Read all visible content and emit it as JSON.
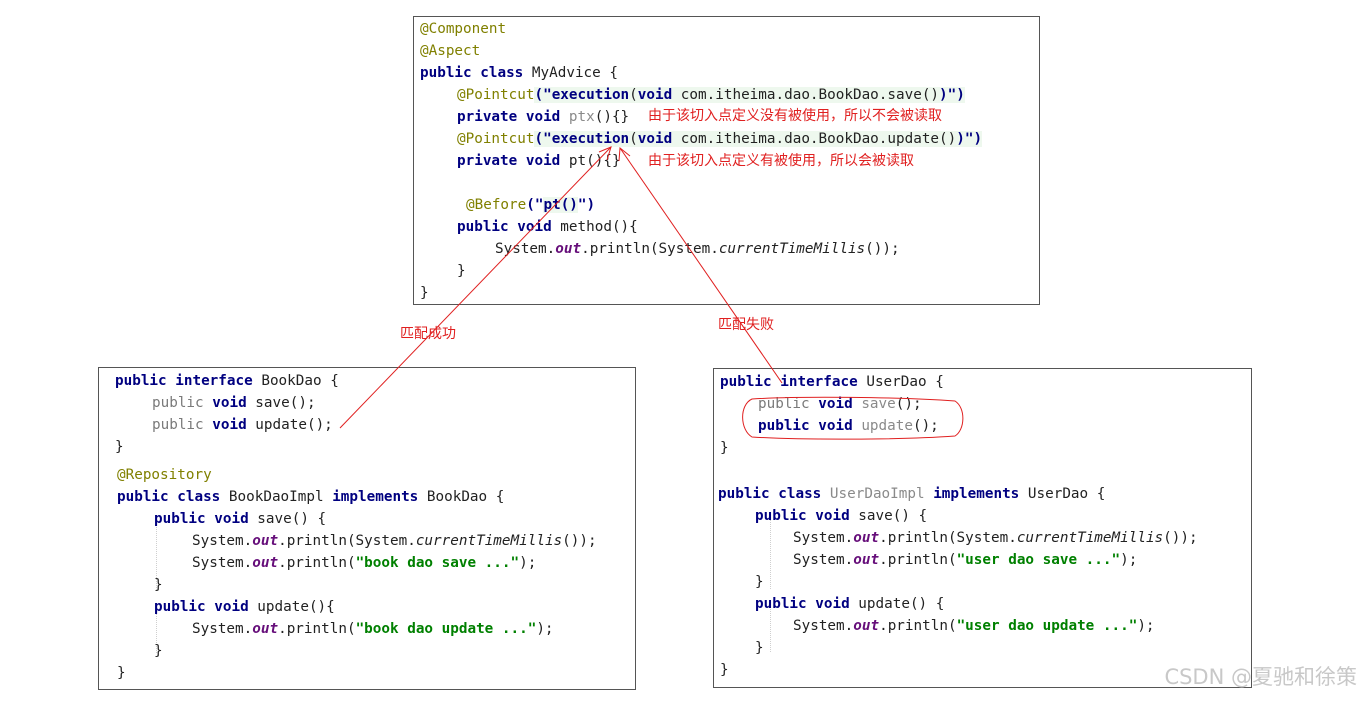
{
  "top_box": {
    "l1": "@Component",
    "l2": "@Aspect",
    "l3": [
      "public class",
      " MyAdvice {"
    ],
    "l4": [
      "@Pointcut",
      "(\"",
      "execution",
      "(",
      "void",
      " com.itheima.dao.BookDao.save()",
      ")\")"
    ],
    "l5": [
      "private void",
      " ",
      "ptx",
      "(){}"
    ],
    "l6": [
      "@Pointcut",
      "(\"",
      "execution",
      "(",
      "void",
      " com.itheima.dao.BookDao.update()",
      ")\")"
    ],
    "l7": [
      "private void",
      " pt(){}"
    ],
    "l8": [
      "@Before",
      "(\"",
      "pt()",
      "\")"
    ],
    "l9": [
      "public void",
      " method(){"
    ],
    "l10": [
      "System.",
      "out",
      ".println(System.",
      "currentTimeMillis",
      "());"
    ],
    "l11": "}",
    "l12": "}"
  },
  "notes": {
    "ptx_note": "由于该切入点定义没有被使用，所以不会被读取",
    "pt_note": "由于该切入点定义有被使用，所以会被读取",
    "match_success": "匹配成功",
    "match_fail": "匹配失败"
  },
  "left_box": {
    "l1": [
      "public interface",
      " BookDao {"
    ],
    "l2": [
      "public",
      " ",
      "void",
      " save();"
    ],
    "l3": [
      "public",
      " ",
      "void",
      " update();"
    ],
    "l4": "}",
    "l5": "@Repository",
    "l6": [
      "public class",
      " BookDaoImpl ",
      "implements",
      " BookDao {"
    ],
    "l7": [
      "public void",
      " save() {"
    ],
    "l8": [
      "System.",
      "out",
      ".println(System.",
      "currentTimeMillis",
      "());"
    ],
    "l9": [
      "System.",
      "out",
      ".println(",
      "\"book dao save ...\"",
      ");"
    ],
    "l10": "}",
    "l11": [
      "public void",
      " update(){"
    ],
    "l12": [
      "System.",
      "out",
      ".println(",
      "\"book dao update ...\"",
      ");"
    ],
    "l13": "}",
    "l14": "}"
  },
  "right_box": {
    "l1": [
      "public interface",
      " UserDao {"
    ],
    "l2": [
      "public",
      " ",
      "void",
      " ",
      "save",
      "();"
    ],
    "l3": [
      "public",
      " ",
      "void",
      " ",
      "update",
      "();"
    ],
    "l4": "}",
    "l5": [
      "public class",
      " ",
      "UserDaoImpl",
      " ",
      "implements",
      " UserDao {"
    ],
    "l6": [
      "public void",
      " save() {"
    ],
    "l7": [
      "System.",
      "out",
      ".println(System.",
      "currentTimeMillis",
      "());"
    ],
    "l8": [
      "System.",
      "out",
      ".println(",
      "\"user dao save ...\"",
      ");"
    ],
    "l9": "}",
    "l10": [
      "public void",
      " update() {"
    ],
    "l11": [
      "System.",
      "out",
      ".println(",
      "\"user dao update ...\"",
      ");"
    ],
    "l12": "}",
    "l13": "}"
  },
  "watermark": "CSDN @夏驰和徐策",
  "colors": {
    "keyword": "#000080",
    "annotation": "#808000",
    "string": "#008000",
    "arrow": "#e02020"
  }
}
